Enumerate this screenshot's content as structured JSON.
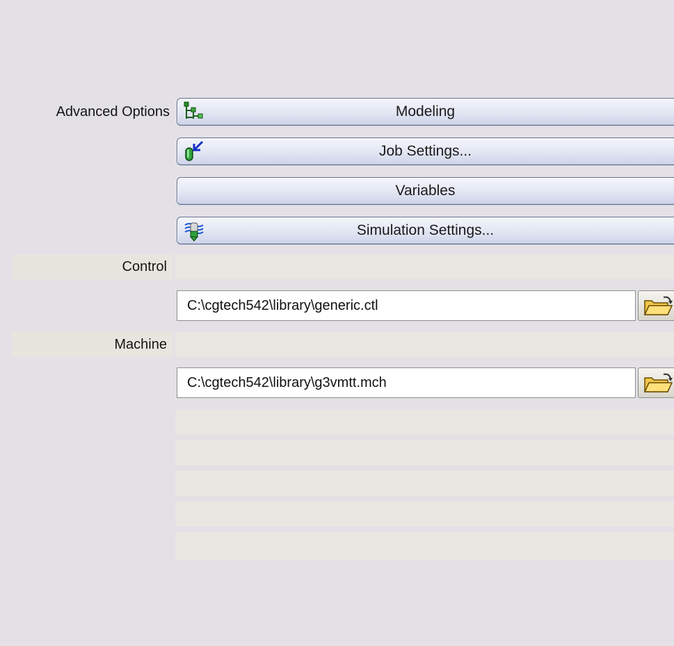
{
  "advanced_options": {
    "label": "Advanced Options",
    "buttons": [
      {
        "label": "Modeling",
        "icon": "modeling-tree-icon"
      },
      {
        "label": "Job Settings...",
        "icon": "job-settings-icon"
      },
      {
        "label": "Variables",
        "icon": ""
      },
      {
        "label": "Simulation Settings...",
        "icon": "simulation-settings-icon"
      }
    ]
  },
  "control": {
    "label": "Control",
    "path": "C:\\cgtech542\\library\\generic.ctl",
    "browse_icon": "folder-open-icon"
  },
  "machine": {
    "label": "Machine",
    "path": "C:\\cgtech542\\library\\g3vmtt.mch",
    "browse_icon": "folder-open-icon"
  }
}
